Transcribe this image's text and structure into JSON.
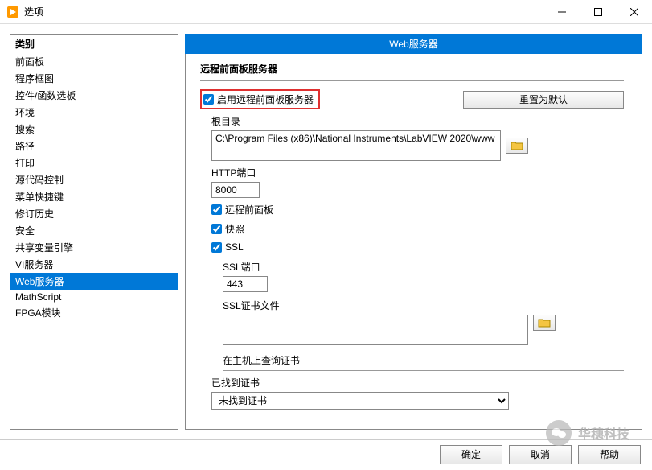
{
  "window": {
    "title": "选项"
  },
  "sidebar": {
    "header": "类别",
    "items": [
      "前面板",
      "程序框图",
      "控件/函数选板",
      "环境",
      "搜索",
      "路径",
      "打印",
      "源代码控制",
      "菜单快捷键",
      "修订历史",
      "安全",
      "共享变量引擎",
      "VI服务器",
      "Web服务器",
      "MathScript",
      "FPGA模块"
    ],
    "selected": 13
  },
  "header_bar": "Web服务器",
  "section": {
    "title": "远程前面板服务器",
    "enable_label": "启用远程前面板服务器",
    "enable_checked": true,
    "reset_label": "重置为默认",
    "root_label": "根目录",
    "root_value": "C:\\Program Files (x86)\\National Instruments\\LabVIEW 2020\\www",
    "http_port_label": "HTTP端口",
    "http_port_value": "8000",
    "remote_panel_label": "远程前面板",
    "remote_panel_checked": true,
    "snapshot_label": "快照",
    "snapshot_checked": true,
    "ssl_label": "SSL",
    "ssl_checked": true,
    "ssl_port_label": "SSL端口",
    "ssl_port_value": "443",
    "ssl_cert_file_label": "SSL证书文件",
    "ssl_cert_file_value": "",
    "host_lookup_label": "在主机上查询证书",
    "found_cert_label": "已找到证书",
    "found_cert_value": "未找到证书"
  },
  "footer": {
    "ok": "确定",
    "cancel": "取消",
    "help": "帮助"
  },
  "watermark": "华穗科技"
}
